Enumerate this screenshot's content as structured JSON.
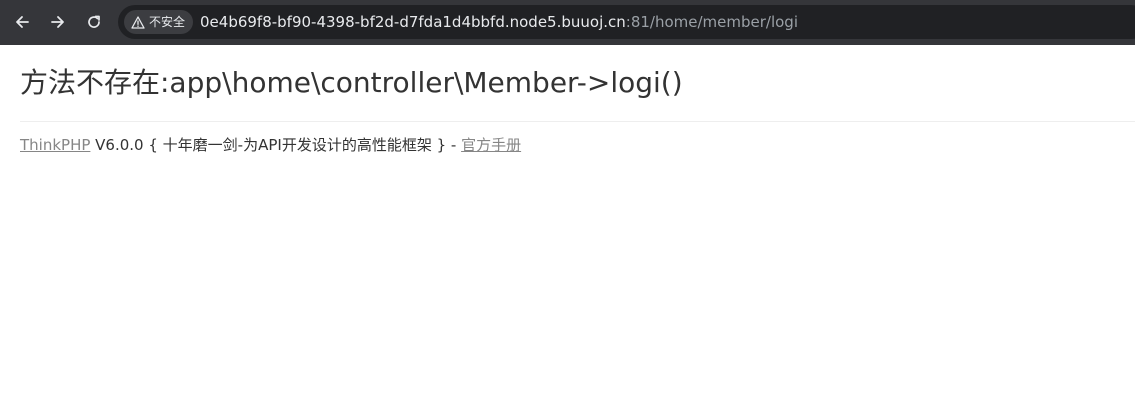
{
  "browser": {
    "icons": {
      "back": "back-arrow-icon",
      "forward": "forward-arrow-icon",
      "reload": "reload-icon",
      "security": "warning-triangle-icon"
    },
    "security_label": "不安全",
    "url_host": "0e4b69f8-bf90-4398-bf2d-d7fda1d4bbfd.node5.buuoj.cn",
    "url_rest": ":81/home/member/logi"
  },
  "page": {
    "error_title": "方法不存在:app\\home\\controller\\Member->logi()",
    "framework_link": "ThinkPHP",
    "version_text": " V6.0.0 { 十年磨一剑-为API开发设计的高性能框架 } - ",
    "manual_link": "官方手册"
  },
  "colors": {
    "toolbar_bg": "#35363a",
    "omnibox_bg": "#202124",
    "title_text": "#333333",
    "link": "#868686"
  }
}
